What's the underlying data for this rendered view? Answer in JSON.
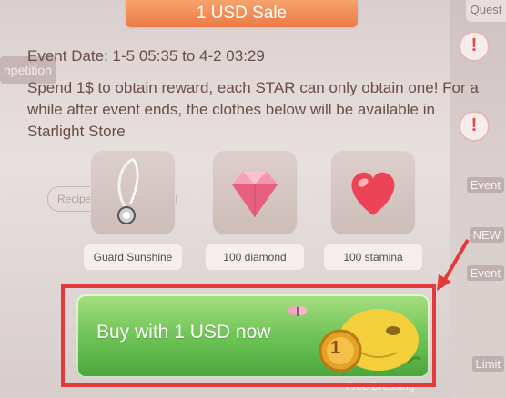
{
  "background": {
    "left_sign": "npetition",
    "recipe_badge": "Recipe Wo...",
    "quest_tab": "Quest",
    "right_labels": [
      "Event",
      "NEW",
      "Event",
      "Limit"
    ],
    "free_dressing": "Free Dressing"
  },
  "dialog": {
    "title": "1 USD Sale",
    "event_date": "Event Date: 1-5 05:35 to 4-2 03:29",
    "description": "Spend 1$ to obtain reward, each STAR can only obtain one! For a while after event ends, the clothes below will be available in Starlight Store"
  },
  "rewards": [
    {
      "label": "Guard Sunshine",
      "icon": "necklace-icon"
    },
    {
      "label": "100 diamond",
      "icon": "diamond-icon"
    },
    {
      "label": "100 stamina",
      "icon": "heart-icon"
    }
  ],
  "buy_button": {
    "label": "Buy with 1 USD now",
    "coin_number": "1"
  },
  "colors": {
    "banner": "#ec7a45",
    "button": "#6bc153",
    "highlight": "#e23b3b"
  }
}
